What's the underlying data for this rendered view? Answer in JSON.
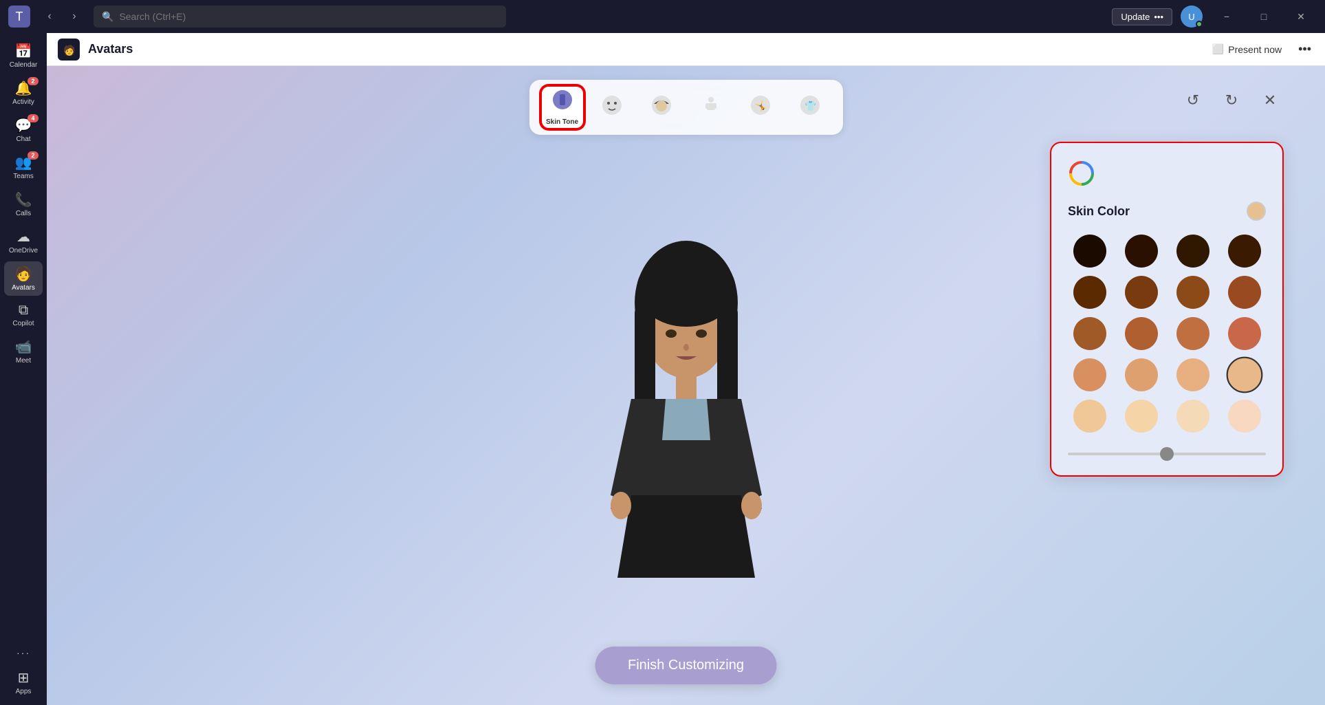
{
  "titleBar": {
    "searchPlaceholder": "Search (Ctrl+E)",
    "updateLabel": "Update",
    "updateMore": "•••",
    "minimize": "−",
    "maximize": "□",
    "close": "✕"
  },
  "sidebar": {
    "items": [
      {
        "id": "calendar",
        "label": "Calendar",
        "icon": "📅",
        "badge": null,
        "active": false
      },
      {
        "id": "activity",
        "label": "Activity",
        "icon": "🔔",
        "badge": "2",
        "active": false
      },
      {
        "id": "chat",
        "label": "Chat",
        "icon": "💬",
        "badge": "4",
        "active": false
      },
      {
        "id": "teams",
        "label": "Teams",
        "icon": "👥",
        "badge": "2",
        "active": false
      },
      {
        "id": "calls",
        "label": "Calls",
        "icon": "📞",
        "badge": null,
        "active": false
      },
      {
        "id": "onedrive",
        "label": "OneDrive",
        "icon": "☁",
        "badge": null,
        "active": false
      },
      {
        "id": "avatars",
        "label": "Avatars",
        "icon": "🧑",
        "badge": null,
        "active": true
      },
      {
        "id": "copilot",
        "label": "Copilot",
        "icon": "⧉",
        "badge": null,
        "active": false
      },
      {
        "id": "meet",
        "label": "Meet",
        "icon": "📹",
        "badge": null,
        "active": false
      },
      {
        "id": "more",
        "label": "•••",
        "icon": "•••",
        "badge": null,
        "active": false
      },
      {
        "id": "apps",
        "label": "Apps",
        "icon": "⊞",
        "badge": null,
        "active": false
      }
    ]
  },
  "header": {
    "appIcon": "🧑",
    "title": "Avatars",
    "presentLabel": "Present now",
    "moreLabel": "•••"
  },
  "toolbar": {
    "items": [
      {
        "id": "skin-tone",
        "label": "Skin Tone",
        "icon": "🖌",
        "selected": true
      },
      {
        "id": "face",
        "label": "",
        "icon": "😊",
        "selected": false
      },
      {
        "id": "hair",
        "label": "",
        "icon": "💇",
        "selected": false
      },
      {
        "id": "body",
        "label": "",
        "icon": "👤",
        "selected": false
      },
      {
        "id": "accessories",
        "label": "",
        "icon": "🤸",
        "selected": false
      },
      {
        "id": "clothing",
        "label": "",
        "icon": "👕",
        "selected": false
      }
    ],
    "actions": {
      "undo": "↺",
      "redo": "↻",
      "close": "✕"
    }
  },
  "skinPanel": {
    "title": "Skin Color",
    "selectedColor": "#e8c090",
    "colors": [
      "#1a0a00",
      "#2a1000",
      "#301800",
      "#3a1a00",
      "#5c2a00",
      "#7a3a10",
      "#8b4a18",
      "#9a4a20",
      "#a05a28",
      "#b06030",
      "#c07040",
      "#c86848",
      "#d89060",
      "#dfa070",
      "#e8b080",
      "#e8b888",
      "#f0c898",
      "#f5d4a8",
      "#f5dab8",
      "#f8d8c0"
    ],
    "sliderValue": 50
  },
  "finishBtn": {
    "label": "Finish Customizing"
  }
}
